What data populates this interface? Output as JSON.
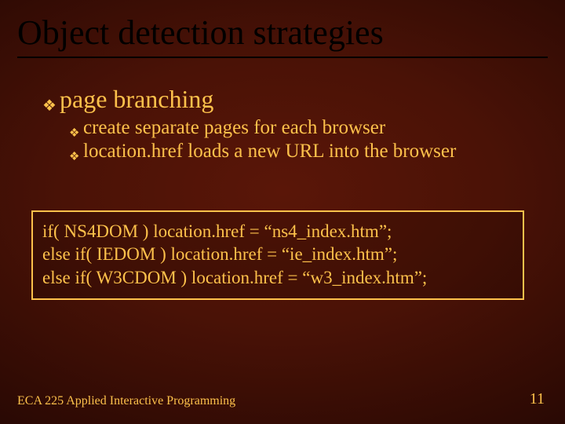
{
  "title": "Object detection strategies",
  "bullets": {
    "l1_0": "page branching",
    "l2_0": "create separate pages for each browser",
    "l2_1": "location.href loads a new URL into the browser"
  },
  "code": {
    "line1": "if( NS4DOM ) location.href = “ns4_index.htm”;",
    "line2": "else if( IEDOM ) location.href = “ie_index.htm”;",
    "line3": "else if( W3CDOM ) location.href = “w3_index.htm”;"
  },
  "footer": {
    "left": "ECA 225   Applied Interactive Programming",
    "right": "11"
  }
}
